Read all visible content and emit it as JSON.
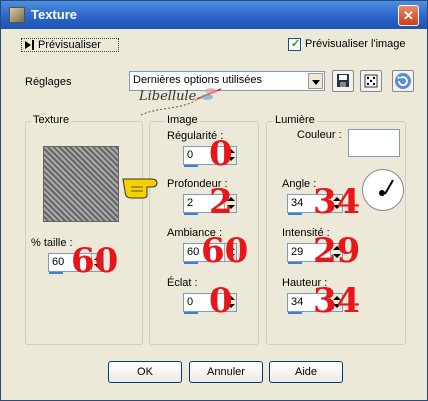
{
  "window": {
    "title": "Texture",
    "close_glyph": "✕"
  },
  "preview": {
    "button_label": "Prévisualiser",
    "checkbox_label": "Prévisualiser l'image",
    "checkbox_checked": true
  },
  "settings": {
    "label": "Réglages",
    "preset_value": "Dernières options utilisées"
  },
  "logo": {
    "text": "Libellule"
  },
  "texture_group": {
    "label": "Texture",
    "size_label": "% taille :",
    "size_value": "60",
    "size_annotation": "60"
  },
  "image_group": {
    "label": "Image",
    "regularity_label": "Régularité :",
    "regularity_value": "0",
    "regularity_annotation": "0",
    "depth_label": "Profondeur :",
    "depth_value": "2",
    "depth_annotation": "2",
    "ambiance_label": "Ambiance :",
    "ambiance_value": "60",
    "ambiance_annotation": "60",
    "eclat_label": "Éclat :",
    "eclat_value": "0",
    "eclat_annotation": "0"
  },
  "light_group": {
    "label": "Lumière",
    "color_label": "Couleur :",
    "angle_label": "Angle :",
    "angle_value": "34",
    "angle_annotation": "34",
    "intensity_label": "Intensité :",
    "intensity_value": "29",
    "intensity_annotation": "29",
    "height_label": "Hauteur :",
    "height_value": "34",
    "height_annotation": "34"
  },
  "buttons": {
    "ok": "OK",
    "cancel": "Annuler",
    "help": "Aide"
  },
  "colors": {
    "annotation": "#e8151a",
    "titlebar": "#2a62c9",
    "check": "#21a121"
  }
}
